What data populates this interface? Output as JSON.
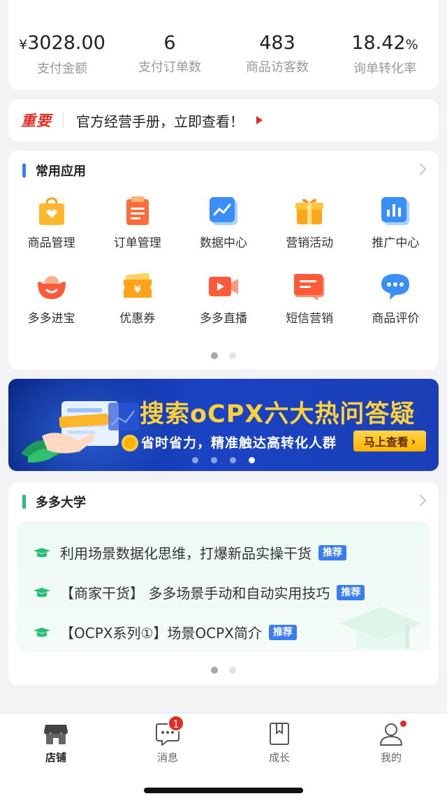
{
  "stats": [
    {
      "prefix": "¥",
      "value": "3028.00",
      "unit": "",
      "label": "支付金额"
    },
    {
      "prefix": "",
      "value": "6",
      "unit": "",
      "label": "支付订单数"
    },
    {
      "prefix": "",
      "value": "483",
      "unit": "",
      "label": "商品访客数"
    },
    {
      "prefix": "",
      "value": "18.42",
      "unit": "%",
      "label": "询单转化率"
    }
  ],
  "notice": {
    "tag": "重要",
    "text": "官方经营手册，立即查看！",
    "tag_color": "#e02e24"
  },
  "apps": {
    "title": "常用应用",
    "bar_color": "#3a7df0",
    "items": [
      {
        "label": "商品管理",
        "icon": "shopping-bag-icon"
      },
      {
        "label": "订单管理",
        "icon": "clipboard-icon"
      },
      {
        "label": "数据中心",
        "icon": "line-chart-icon"
      },
      {
        "label": "营销活动",
        "icon": "gift-box-icon"
      },
      {
        "label": "推广中心",
        "icon": "bar-chart-icon"
      },
      {
        "label": "多多进宝",
        "icon": "ingot-icon"
      },
      {
        "label": "优惠券",
        "icon": "coupon-icon"
      },
      {
        "label": "多多直播",
        "icon": "video-camera-icon"
      },
      {
        "label": "短信营销",
        "icon": "sms-icon"
      },
      {
        "label": "商品评价",
        "icon": "comment-icon"
      }
    ],
    "page_count": 2,
    "active_page": 1
  },
  "banner": {
    "title": "搜索oCPX六大热问答疑",
    "subtitle": "省时省力，精准触达高转化人群",
    "button": "马上查看",
    "page_count": 4,
    "active_page": 4
  },
  "university": {
    "title": "多多大学",
    "bar_color": "#27c07b",
    "items": [
      {
        "text": "利用场景数据化思维，打爆新品实操干货",
        "tag": "推荐"
      },
      {
        "text": "【商家干货】 多多场景手动和自动实用技巧",
        "tag": "推荐"
      },
      {
        "text": "【OCPX系列①】场景OCPX简介",
        "tag": "推荐"
      }
    ],
    "page_count": 2,
    "active_page": 1
  },
  "tabbar": [
    {
      "label": "店铺",
      "icon": "store-icon",
      "active": true
    },
    {
      "label": "消息",
      "icon": "message-icon",
      "badge": "1"
    },
    {
      "label": "成长",
      "icon": "bookmark-icon"
    },
    {
      "label": "我的",
      "icon": "user-icon",
      "dot": true
    }
  ]
}
